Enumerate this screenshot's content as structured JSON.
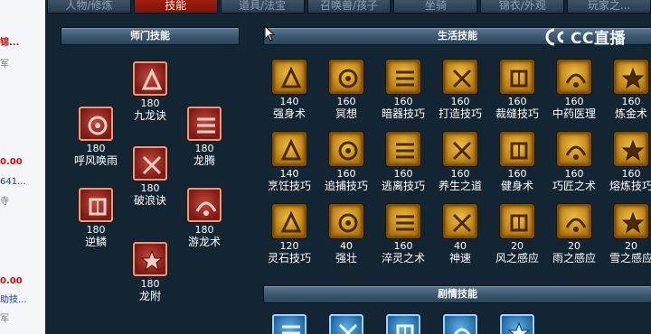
{
  "left_strip": {
    "items": [
      {
        "text": "锦...",
        "style": "red"
      },
      {
        "text": "军",
        "style": "grey"
      },
      {
        "text": "0.00",
        "style": "red"
      },
      {
        "text": "641...",
        "style": "blue"
      },
      {
        "text": "寺",
        "style": "grey"
      },
      {
        "text": "0.00",
        "style": "red"
      },
      {
        "text": "助技...",
        "style": "blue"
      },
      {
        "text": "军",
        "style": "grey"
      }
    ]
  },
  "tabs": [
    {
      "label": "人物/修炼",
      "active": false
    },
    {
      "label": "技能",
      "active": true
    },
    {
      "label": "道具/法宝",
      "active": false
    },
    {
      "label": "召唤兽/孩子",
      "active": false
    },
    {
      "label": "坐骑",
      "active": false
    },
    {
      "label": "锦衣/外观",
      "active": false
    },
    {
      "label": "玩家之...",
      "active": false
    }
  ],
  "sections": {
    "sect": "师门技能",
    "life": "生活技能",
    "story": "剧情技能"
  },
  "watermark": {
    "text": "CC直播"
  },
  "sect_skills": [
    {
      "name": "九龙诀",
      "level": "180",
      "icon": "dragon-scroll-icon"
    },
    {
      "name": "呼风唤雨",
      "level": "180",
      "icon": "wind-rain-icon"
    },
    {
      "name": "龙腾",
      "level": "180",
      "icon": "dragon-soar-icon"
    },
    {
      "name": "破浪诀",
      "level": "180",
      "icon": "wave-scroll-icon"
    },
    {
      "name": "逆鳞",
      "level": "180",
      "icon": "reverse-scale-icon"
    },
    {
      "name": "游龙术",
      "level": "180",
      "icon": "swimming-dragon-icon"
    },
    {
      "name": "龙附",
      "level": "180",
      "icon": "dragon-attach-icon"
    }
  ],
  "life_skills": [
    {
      "name": "强身术",
      "level": "140",
      "icon": "strength-icon"
    },
    {
      "name": "冥想",
      "level": "160",
      "icon": "meditation-icon"
    },
    {
      "name": "暗器技巧",
      "level": "160",
      "icon": "dart-icon"
    },
    {
      "name": "打造技巧",
      "level": "160",
      "icon": "forging-icon"
    },
    {
      "name": "裁缝技巧",
      "level": "160",
      "icon": "tailoring-icon"
    },
    {
      "name": "中药医理",
      "level": "160",
      "icon": "herb-icon"
    },
    {
      "name": "炼金术",
      "level": "160",
      "icon": "alchemy-icon"
    },
    {
      "name": "烹饪技巧",
      "level": "140",
      "icon": "cooking-icon"
    },
    {
      "name": "追捕技巧",
      "level": "160",
      "icon": "pursuit-icon"
    },
    {
      "name": "逃离技巧",
      "level": "160",
      "icon": "escape-icon"
    },
    {
      "name": "养生之道",
      "level": "160",
      "icon": "health-icon"
    },
    {
      "name": "健身术",
      "level": "160",
      "icon": "fitness-icon"
    },
    {
      "name": "巧匠之术",
      "level": "160",
      "icon": "craftsman-icon"
    },
    {
      "name": "熔炼技巧",
      "level": "160",
      "icon": "smelting-icon"
    },
    {
      "name": "灵石技巧",
      "level": "120",
      "icon": "spirit-stone-icon"
    },
    {
      "name": "强壮",
      "level": "40",
      "icon": "muscle-icon"
    },
    {
      "name": "淬灵之术",
      "level": "160",
      "icon": "temper-icon"
    },
    {
      "name": "神速",
      "level": "40",
      "icon": "speed-icon"
    },
    {
      "name": "风之感应",
      "level": "20",
      "icon": "wind-sense-icon"
    },
    {
      "name": "雨之感应",
      "level": "20",
      "icon": "rain-sense-icon"
    },
    {
      "name": "雪之感应",
      "level": "20",
      "icon": "snow-sense-icon"
    }
  ],
  "story_skills": [
    {
      "icon": "story-skill-1-icon"
    },
    {
      "icon": "story-skill-2-icon"
    },
    {
      "icon": "story-skill-3-icon"
    },
    {
      "icon": "story-skill-4-icon"
    },
    {
      "icon": "story-skill-5-icon"
    }
  ],
  "colors": {
    "background": "#132433",
    "tab_active": "#a51d12",
    "icon_gold": "#d99a28",
    "icon_red": "#a8322a",
    "icon_blue": "#3d8fd0"
  }
}
